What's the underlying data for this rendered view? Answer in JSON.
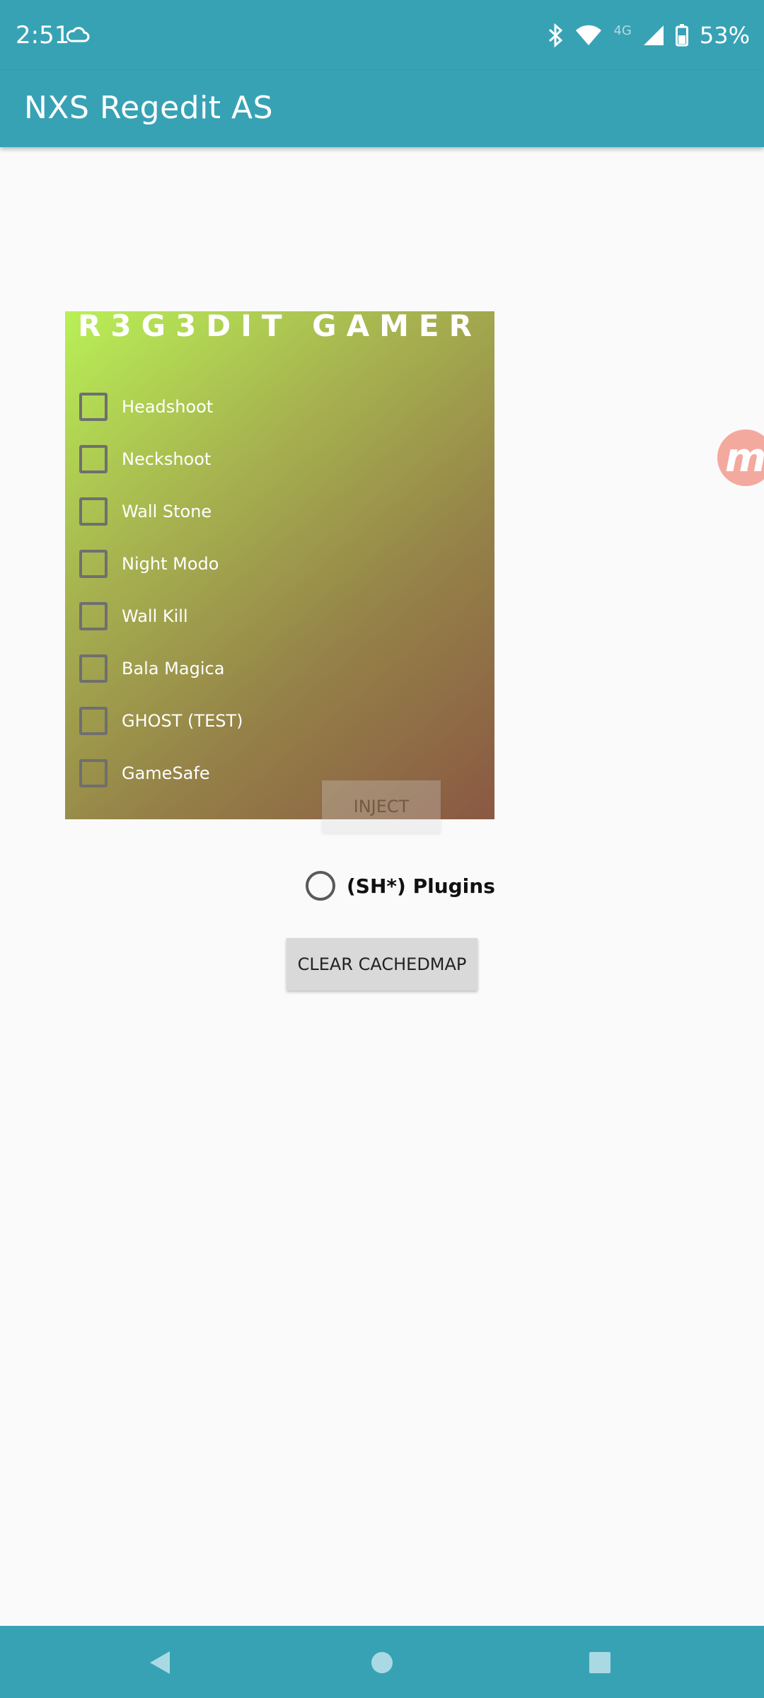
{
  "status": {
    "time": "2:51",
    "network": "4G",
    "battery": "53%"
  },
  "app": {
    "title": "NXS Regedit AS"
  },
  "panel": {
    "title": "R3G3DIT GAMER",
    "options": [
      {
        "label": "Headshoot",
        "checked": false
      },
      {
        "label": "Neckshoot",
        "checked": false
      },
      {
        "label": "Wall Stone",
        "checked": false
      },
      {
        "label": "Night Modo",
        "checked": false
      },
      {
        "label": "Wall Kill",
        "checked": false
      },
      {
        "label": "Bala Magica",
        "checked": false
      },
      {
        "label": "GHOST (TEST)",
        "checked": false
      },
      {
        "label": "GameSafe",
        "checked": false
      }
    ],
    "inject_label": "INJECT"
  },
  "radio": {
    "label": "(SH*) Plugins",
    "selected": false
  },
  "buttons": {
    "clear_label": "CLEAR CACHEDMAP"
  },
  "floating": {
    "label": "m"
  },
  "icons": {
    "cloud": "cloud-icon",
    "bluetooth": "bluetooth-icon",
    "wifi": "wifi-icon",
    "signal": "signal-icon",
    "battery": "battery-icon",
    "back": "back-icon",
    "home": "home-icon",
    "recents": "recents-icon"
  },
  "colors": {
    "primary": "#38a2b5",
    "background": "#fafafa"
  }
}
